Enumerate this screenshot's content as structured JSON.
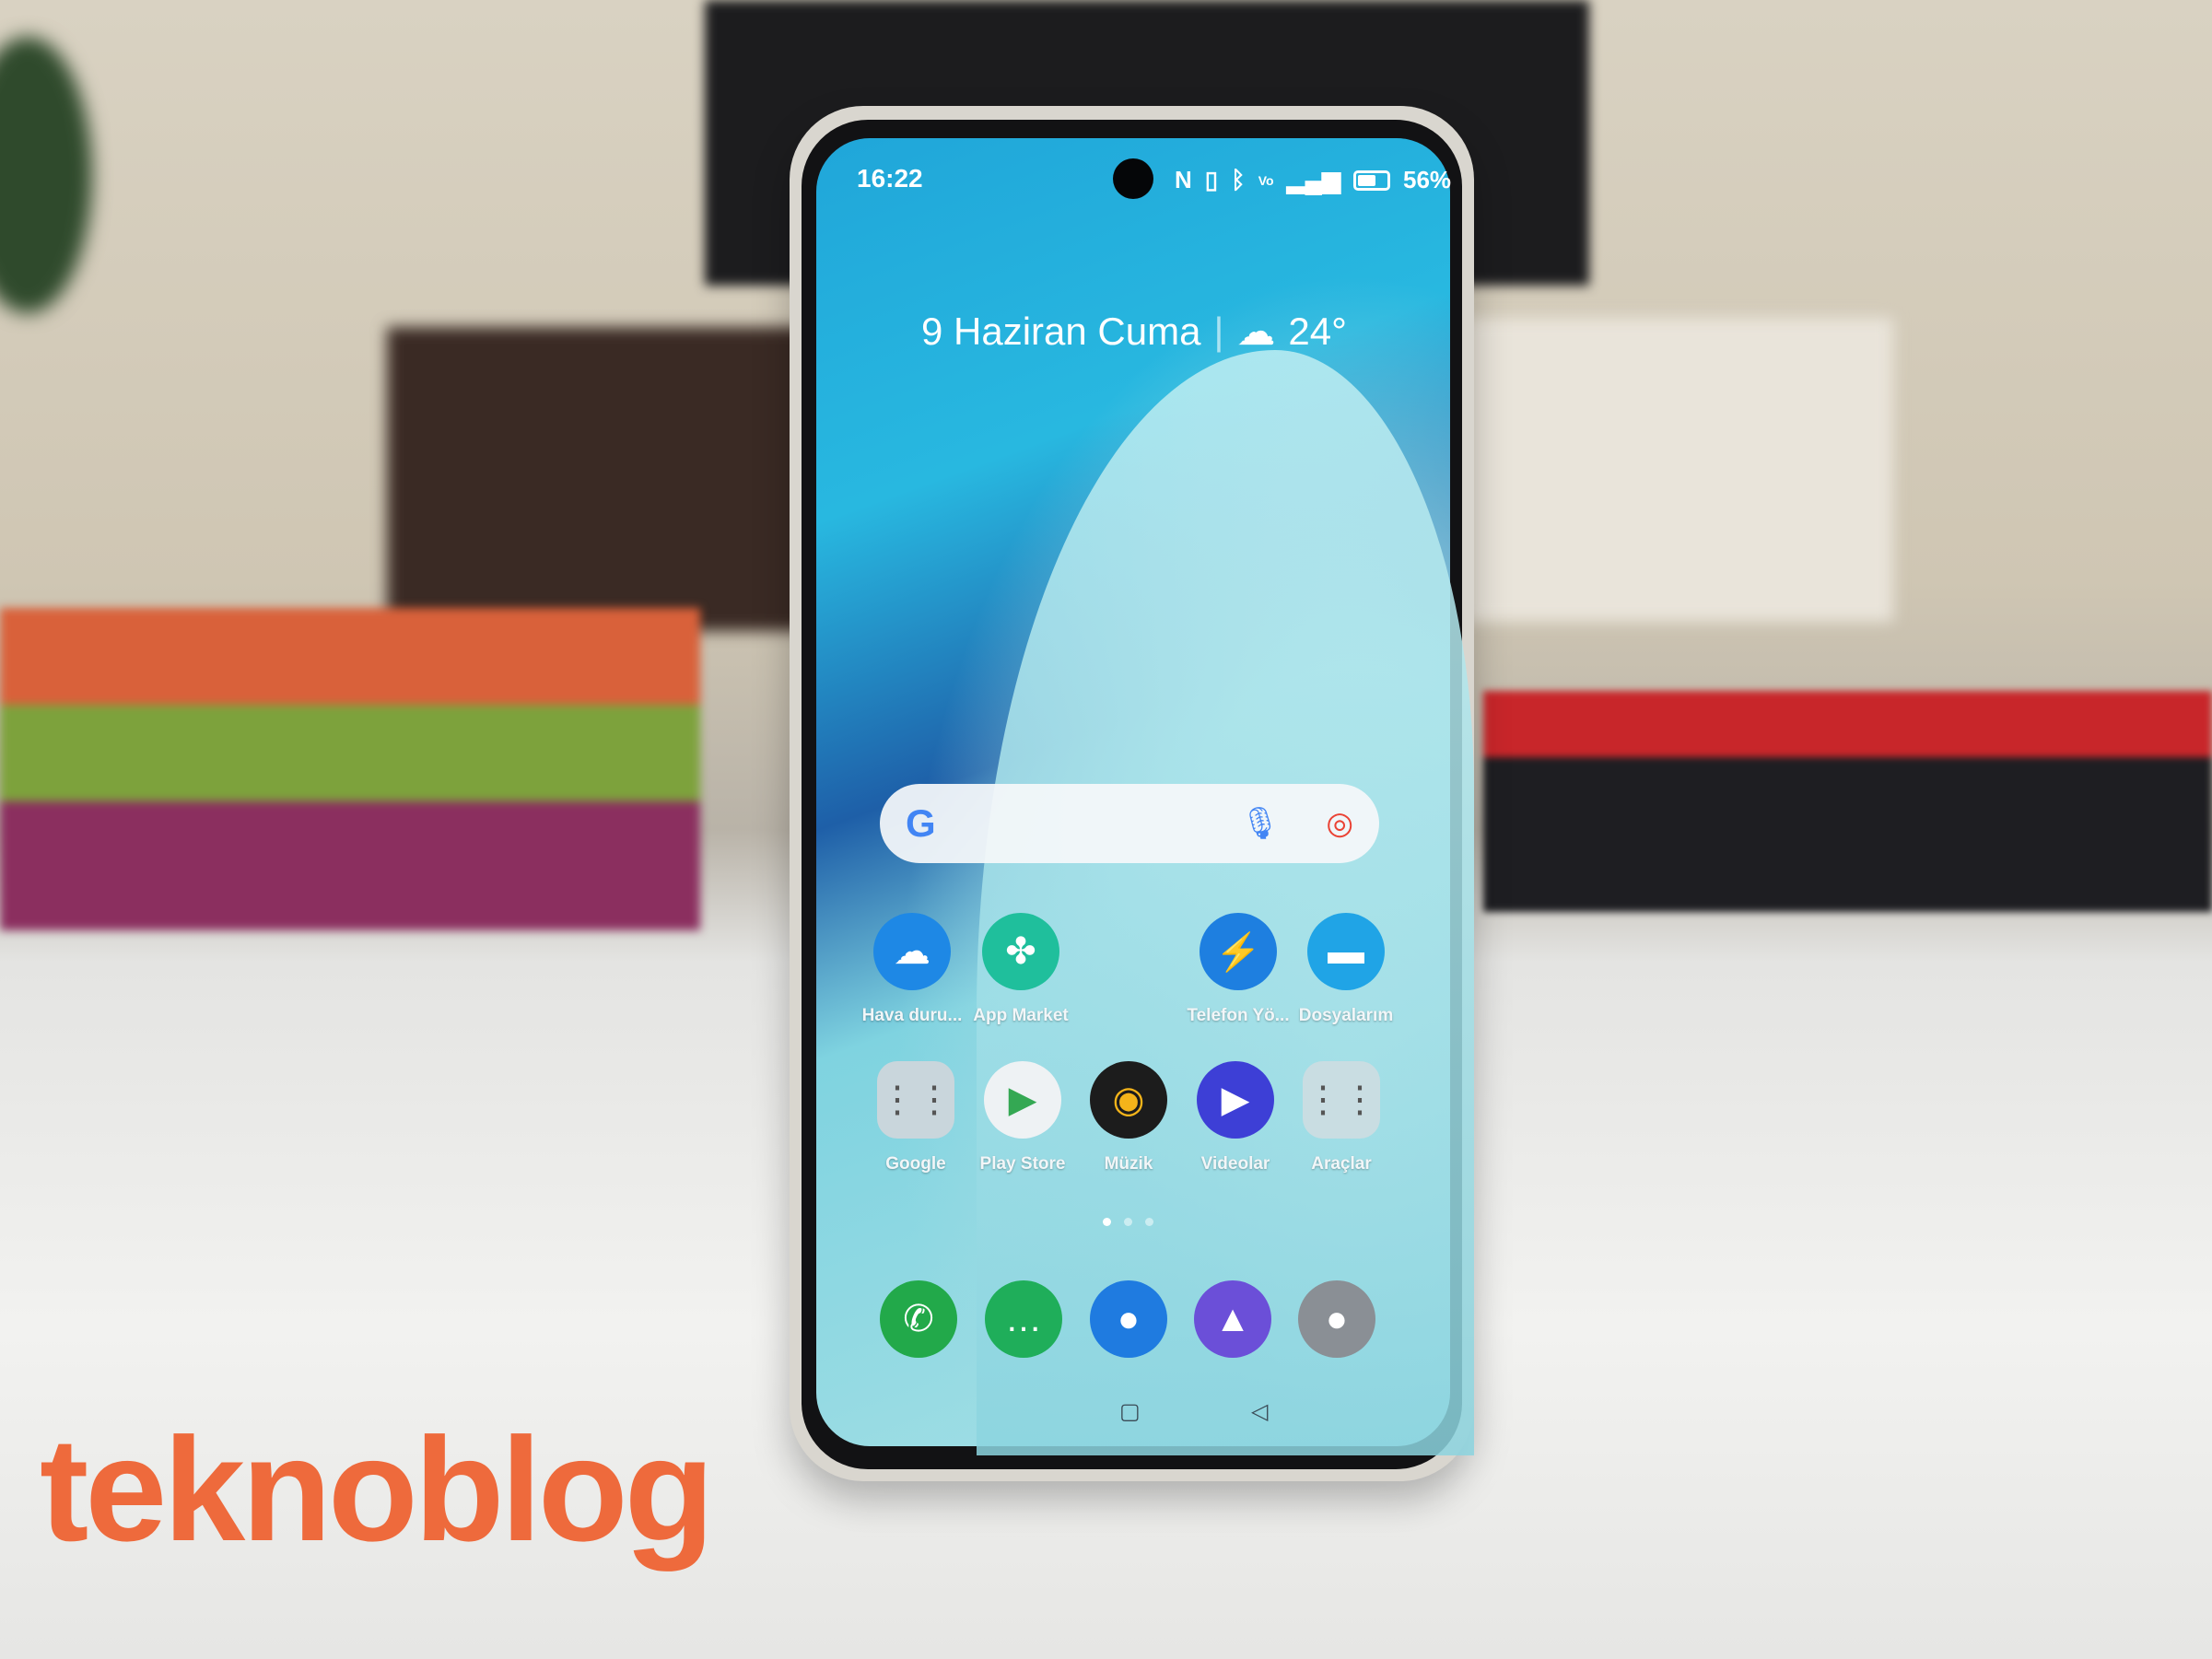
{
  "status_bar": {
    "time": "16:22",
    "icons": [
      "nfc-icon",
      "vibrate-icon",
      "bluetooth-icon",
      "volte-icon",
      "signal-4g-icon"
    ],
    "battery": "56%",
    "battery_level": 56
  },
  "widget": {
    "date": "9 Haziran Cuma",
    "weather_icon": "partly-cloudy-icon",
    "temperature": "24°"
  },
  "search_bar": {
    "logo": "G",
    "icons": [
      "mic-icon",
      "lens-icon"
    ]
  },
  "apps_row1": [
    {
      "label": "Hava duru...",
      "icon": "weather-icon",
      "color": "#1e88e5"
    },
    {
      "label": "App Market",
      "icon": "app-market-icon",
      "color": "#1fbf9c"
    },
    {
      "label": "Telefon Yö...",
      "icon": "phone-manager-icon",
      "color": "#1e7fe0"
    },
    {
      "label": "Dosyalarım",
      "icon": "folder-icon",
      "color": "#20a4e6"
    }
  ],
  "apps_row2": [
    {
      "label": "Google",
      "icon": "google-folder-icon",
      "color": "#c9d6dc"
    },
    {
      "label": "Play Store",
      "icon": "play-store-icon",
      "color": "#eef2f4"
    },
    {
      "label": "Müzik",
      "icon": "music-icon",
      "color": "#1c1c1c"
    },
    {
      "label": "Videolar",
      "icon": "video-icon",
      "color": "#3d3fd6"
    },
    {
      "label": "Araçlar",
      "icon": "tools-folder-icon",
      "color": "#c9dde2"
    }
  ],
  "dock": [
    {
      "icon": "phone-icon",
      "color": "#22a94a"
    },
    {
      "icon": "messages-icon",
      "color": "#1fae5a"
    },
    {
      "icon": "browser-icon",
      "color": "#1f7be0"
    },
    {
      "icon": "gallery-icon",
      "color": "#6b4fd8"
    },
    {
      "icon": "camera-icon",
      "color": "#8a8f95"
    }
  ],
  "page_indicator": {
    "pages": 3,
    "current": 1
  },
  "watermark": "teknoblog",
  "colors": {
    "watermark": "#ee6a3c"
  }
}
